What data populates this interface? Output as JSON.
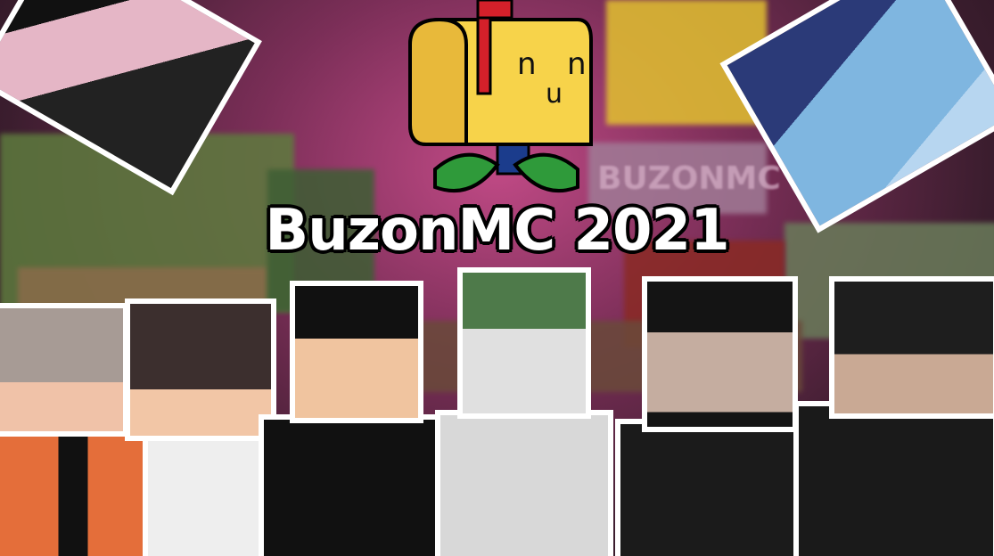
{
  "title": "BuzonMC 2021",
  "logo": {
    "eye_left": "n",
    "eye_right": "n",
    "mouth": "u",
    "colors": {
      "mailbox": "#f7d34a",
      "flag": "#d4202a",
      "leaf": "#2f9a3a",
      "post": "#1b3c8c"
    }
  },
  "background": {
    "sky": "#c14a86",
    "banner": "#f2d032",
    "banner_text": "BUZONMC"
  },
  "characters": [
    "pink-hair-character-upside-down",
    "blue-hair-character-upside-down",
    "gray-hair-orange-jacket",
    "dark-hair-white-shirt",
    "black-hair-open-mouth",
    "frog-hat-white",
    "long-black-hair",
    "black-hoodie-skull"
  ]
}
